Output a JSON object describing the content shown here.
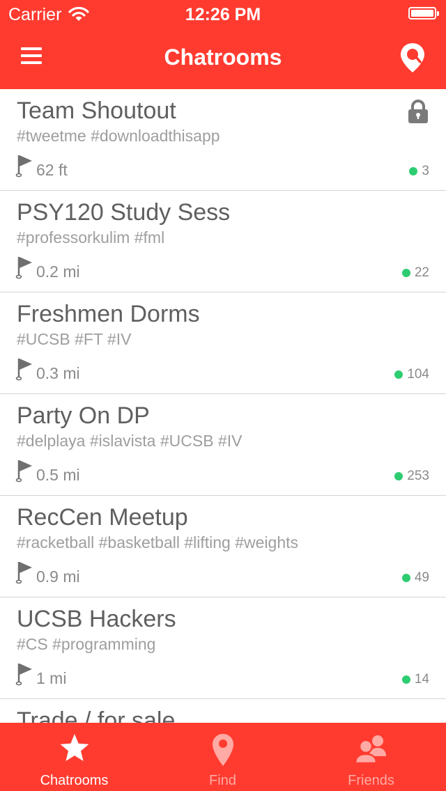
{
  "status_bar": {
    "carrier": "Carrier",
    "time": "12:26 PM"
  },
  "nav": {
    "title": "Chatrooms",
    "left_icon": "menu-icon",
    "right_icon": "location-pin-icon"
  },
  "colors": {
    "accent": "#ff3b30",
    "online_dot": "#2ecc71",
    "text_primary": "#5f5f5f",
    "text_secondary": "#9e9e9e"
  },
  "rooms": [
    {
      "name": "Team Shoutout",
      "tags": "#tweetme #downloadthisapp",
      "distance": "62 ft",
      "members": "3",
      "locked": true
    },
    {
      "name": "PSY120 Study Sess",
      "tags": "#professorkulim #fml",
      "distance": "0.2 mi",
      "members": "22",
      "locked": false
    },
    {
      "name": "Freshmen Dorms",
      "tags": "#UCSB #FT #IV",
      "distance": "0.3 mi",
      "members": "104",
      "locked": false
    },
    {
      "name": "Party On DP",
      "tags": "#delplaya #islavista #UCSB #IV",
      "distance": "0.5 mi",
      "members": "253",
      "locked": false
    },
    {
      "name": "RecCen Meetup",
      "tags": "#racketball #basketball #lifting #weights",
      "distance": "0.9 mi",
      "members": "49",
      "locked": false
    },
    {
      "name": "UCSB Hackers",
      "tags": "#CS #programming",
      "distance": "1 mi",
      "members": "14",
      "locked": false
    },
    {
      "name": "Trade / for sale",
      "tags": "",
      "distance": "",
      "members": "",
      "locked": false
    }
  ],
  "tabs": [
    {
      "label": "Chatrooms",
      "icon": "star-icon",
      "active": true
    },
    {
      "label": "Find",
      "icon": "map-pin-icon",
      "active": false
    },
    {
      "label": "Friends",
      "icon": "friends-icon",
      "active": false
    }
  ]
}
